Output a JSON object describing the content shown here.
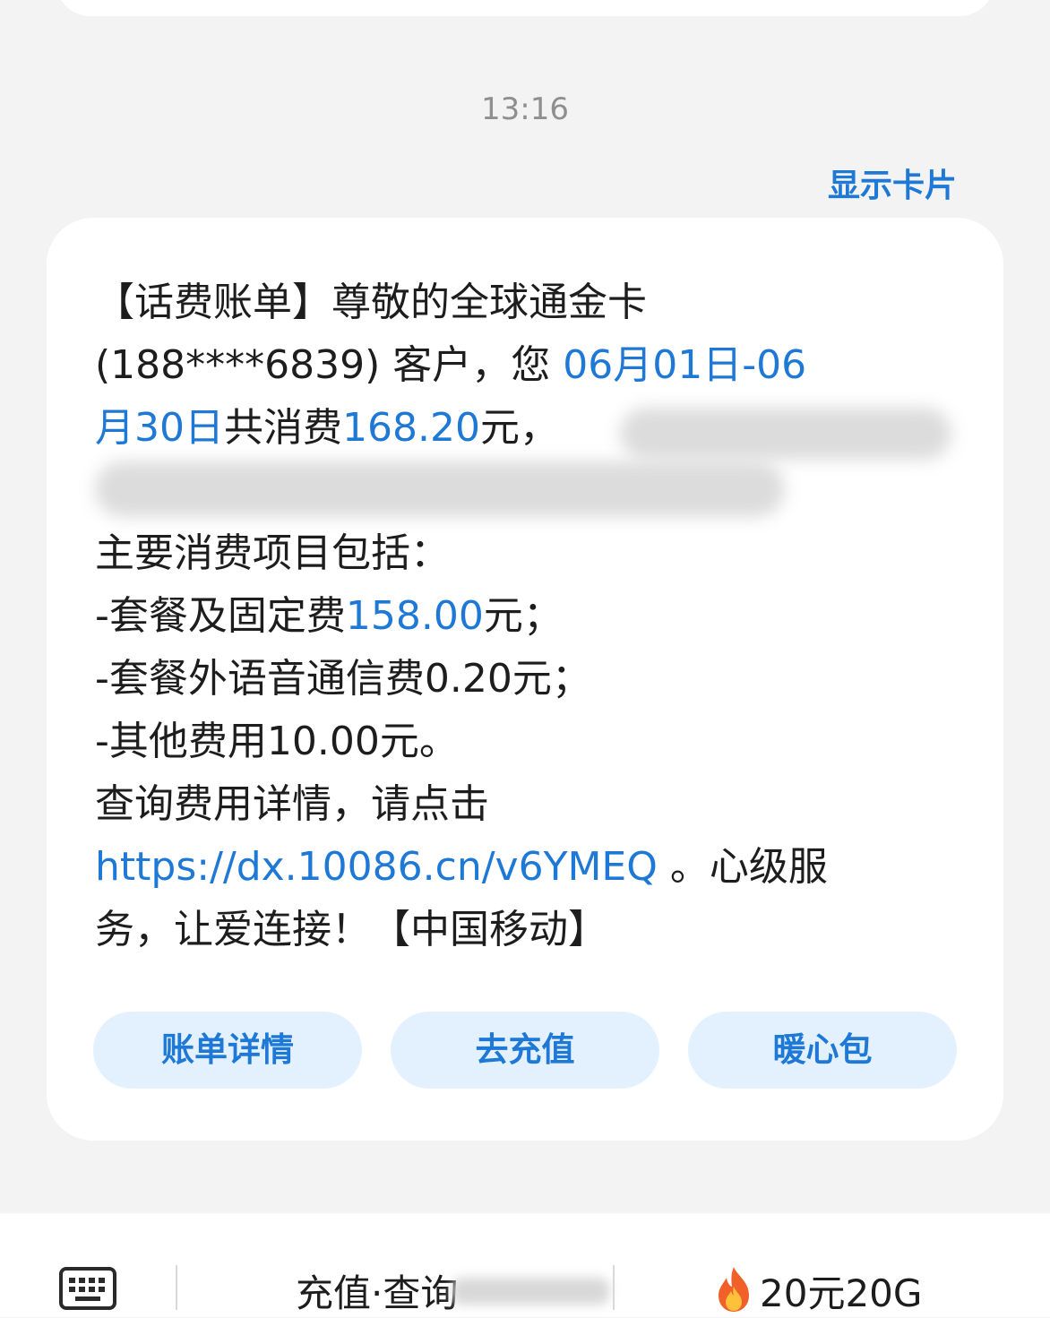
{
  "timestamp": "13:16",
  "show_card_label": "显示卡片",
  "message": {
    "line1": "【话费账单】尊敬的全球通金卡",
    "line2_prefix": "(188****6839) 客户，您 ",
    "line2_date": "06月01日-06",
    "line3_date": "月30日",
    "line3_mid": "共消费",
    "line3_amount": "168.20",
    "line3_suffix": "元，",
    "items_title": "主要消费项目包括：",
    "item1_prefix": "-套餐及固定费",
    "item1_amount": "158.00",
    "item1_suffix": "元；",
    "item2": "-套餐外语音通信费0.20元；",
    "item3": "-其他费用10.00元。",
    "query_text": "查询费用详情，请点击",
    "link": "https://dx.10086.cn/v6YMEQ",
    "after_link": " 。心级服",
    "closing": "务，让爱连接！【中国移动】"
  },
  "actions": [
    {
      "label": "账单详情"
    },
    {
      "label": "去充值"
    },
    {
      "label": "暖心包"
    }
  ],
  "bottom_bar": {
    "keyboard_icon": "keyboard-icon",
    "menu_1": "充值·查询",
    "menu_2_icon": "fire-icon",
    "menu_2": "20元20G"
  },
  "colors": {
    "accent": "#1e78d6",
    "action_bg": "#e3f1ff",
    "page_bg": "#f3f3f3"
  }
}
